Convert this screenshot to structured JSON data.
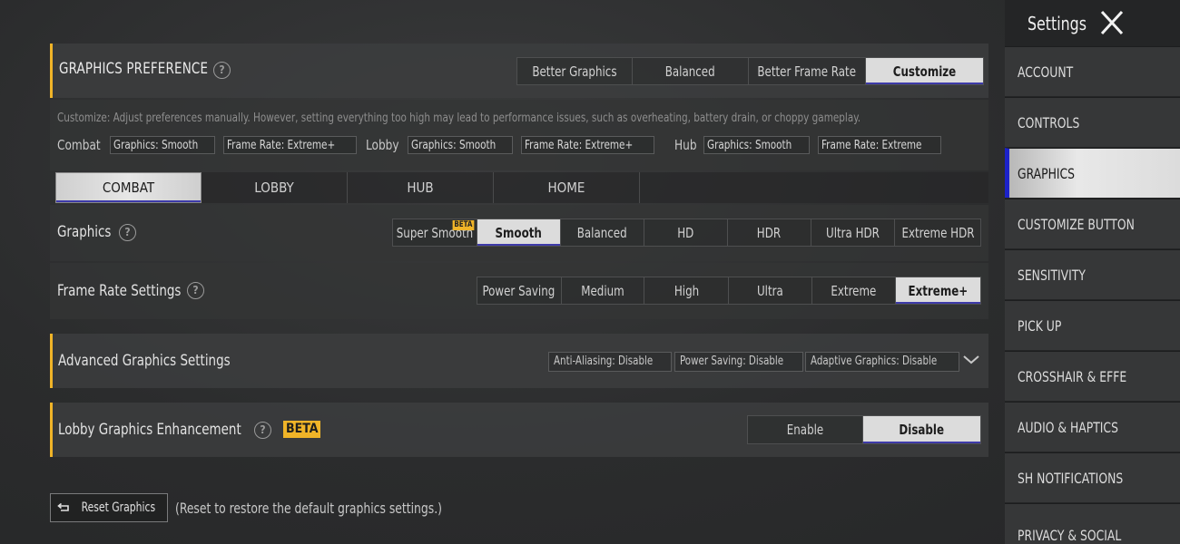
{
  "graphics_preference": {
    "title": "GRAPHICS PREFERENCE",
    "help": "?",
    "options": [
      "Better Graphics",
      "Balanced",
      "Better Frame Rate",
      "Customize"
    ],
    "selected": "Customize"
  },
  "customize": {
    "description": "Customize: Adjust preferences manually. However, setting everything too high may lead to performance issues, such as overheating, battery drain, or choppy gameplay.",
    "modes": [
      {
        "label": "Combat",
        "graphics": "Graphics: Smooth",
        "frame_rate": "Frame Rate: Extreme+"
      },
      {
        "label": "Lobby",
        "graphics": "Graphics: Smooth",
        "frame_rate": "Frame Rate: Extreme+"
      },
      {
        "label": "Hub",
        "graphics": "Graphics: Smooth",
        "frame_rate": "Frame Rate: Extreme"
      }
    ]
  },
  "tabs": [
    "COMBAT",
    "LOBBY",
    "HUB",
    "HOME"
  ],
  "graphics": {
    "label": "Graphics",
    "options": [
      "Super Smooth",
      "Smooth",
      "Balanced",
      "HD",
      "HDR",
      "Ultra HDR",
      "Extreme HDR"
    ],
    "beta_badge": "BETA",
    "selected": "Smooth"
  },
  "frame_rate": {
    "label": "Frame Rate Settings",
    "options": [
      "Power Saving",
      "Medium",
      "High",
      "Ultra",
      "Extreme",
      "Extreme+"
    ],
    "selected": "Extreme+"
  },
  "advanced": {
    "label": "Advanced Graphics Settings",
    "chips": [
      "Anti-Aliasing: Disable",
      "Power Saving: Disable",
      "Adaptive Graphics: Disable"
    ]
  },
  "lobby_enhancement": {
    "label": "Lobby Graphics Enhancement",
    "beta": "BETA",
    "options": [
      "Enable",
      "Disable"
    ],
    "selected": "Disable"
  },
  "reset": {
    "label": "Reset Graphics",
    "note": "(Reset to restore the default graphics settings.)"
  },
  "sidebar": {
    "title": "Settings",
    "items": [
      "ACCOUNT",
      "CONTROLS",
      "GRAPHICS",
      "CUSTOMIZE BUTTON",
      "SENSITIVITY",
      "PICK UP",
      "CROSSHAIR & EFFE",
      "AUDIO & HAPTICS",
      "SH NOTIFICATIONS",
      "PRIVACY & SOCIAL"
    ],
    "selected": "GRAPHICS"
  },
  "colors": {
    "accent": "#f0b428",
    "selected_bg": "#dcdcdc",
    "selected_underline": "#3d3aa8",
    "sidebar_marker": "#1c22c8"
  }
}
